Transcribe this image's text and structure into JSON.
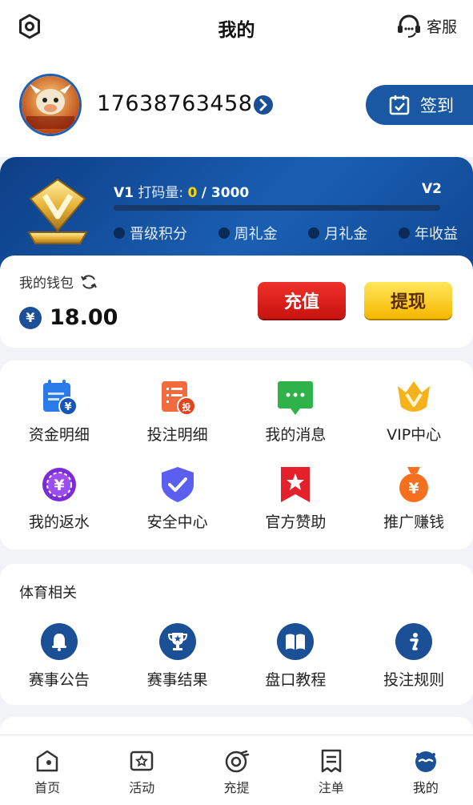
{
  "header": {
    "title": "我的",
    "customer_service": "客服"
  },
  "profile": {
    "phone": "17638763458",
    "sign_in": "签到",
    "avatar_text": "经典牛牛"
  },
  "vip": {
    "current_level": "V1",
    "betting_label": "打码量:",
    "betting_current": "0",
    "betting_target": "/ 3000",
    "next_level": "V2",
    "progress": 0,
    "perks": [
      "晋级积分",
      "周礼金",
      "月礼金",
      "年收益"
    ]
  },
  "wallet": {
    "label": "我的钱包",
    "currency_symbol": "¥",
    "balance": "18.00",
    "recharge": "充值",
    "withdraw": "提现"
  },
  "menu": {
    "items": [
      {
        "label": "资金明细",
        "icon": "fund-details-icon"
      },
      {
        "label": "投注明细",
        "icon": "bet-details-icon"
      },
      {
        "label": "我的消息",
        "icon": "messages-icon"
      },
      {
        "label": "VIP中心",
        "icon": "vip-center-icon"
      },
      {
        "label": "我的返水",
        "icon": "rebate-icon"
      },
      {
        "label": "安全中心",
        "icon": "security-icon"
      },
      {
        "label": "官方赞助",
        "icon": "sponsor-icon"
      },
      {
        "label": "推广赚钱",
        "icon": "promotion-icon"
      }
    ]
  },
  "sports": {
    "title": "体育相关",
    "items": [
      {
        "label": "赛事公告",
        "icon": "bell-icon"
      },
      {
        "label": "赛事结果",
        "icon": "trophy-icon"
      },
      {
        "label": "盘口教程",
        "icon": "book-icon"
      },
      {
        "label": "投注规则",
        "icon": "info-icon"
      }
    ]
  },
  "tabbar": {
    "items": [
      {
        "label": "首页",
        "icon": "home-icon"
      },
      {
        "label": "活动",
        "icon": "activity-icon"
      },
      {
        "label": "充提",
        "icon": "deposit-icon"
      },
      {
        "label": "注单",
        "icon": "orders-icon"
      },
      {
        "label": "我的",
        "icon": "profile-icon"
      }
    ],
    "active": "我的"
  },
  "colors": {
    "primary": "#1a58a4",
    "recharge": "#e0201b",
    "withdraw": "#f7c51a",
    "vip_gold": "#ffd400"
  }
}
